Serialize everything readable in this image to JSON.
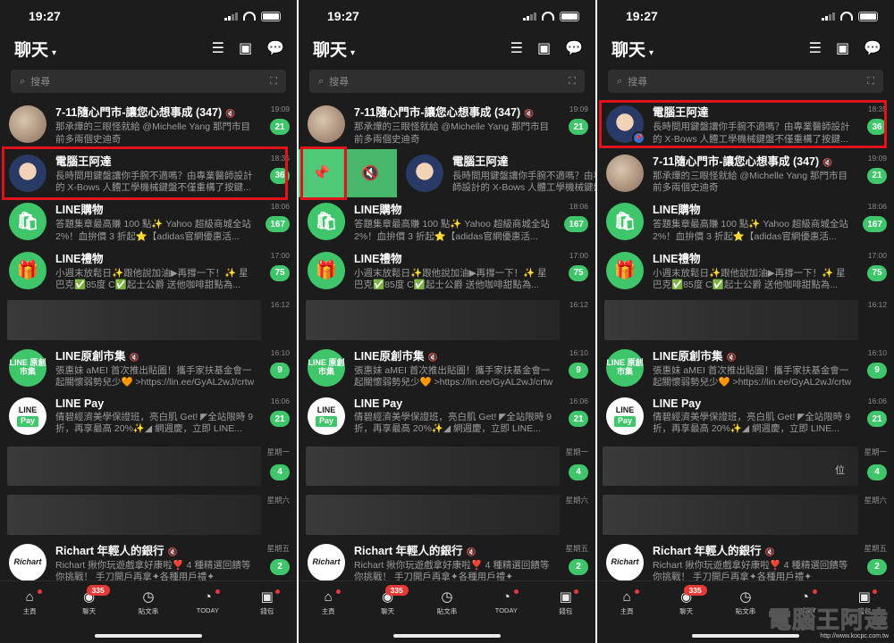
{
  "status": {
    "time": "19:27"
  },
  "header": {
    "title": "聊天",
    "caret": "▾"
  },
  "search": {
    "placeholder": "搜尋"
  },
  "chats": {
    "seven": {
      "name": "7-11隨心門市-讓您心想事成 (347)",
      "msg": "那承燁的三眼怪就給 @Michelle Yang 那門市目前多兩個史迪奇",
      "time": "19:09",
      "count": "21",
      "avatar_label": ""
    },
    "pc": {
      "name": "電腦王阿達",
      "msg": "長時間用鍵盤讓你手腕不適嗎？由專業醫師設計的 X-Bows 人體工學機械鍵盤不僅重構了按鍵...",
      "time": "18:35",
      "count": "36"
    },
    "shop": {
      "name": "LINE購物",
      "msg": "答題集章最高賺 100 點✨ Yahoo 超級商城全站2%！血拚價 3 折起⭐【adidas官網優惠活...",
      "time": "18:06",
      "count": "167"
    },
    "gift": {
      "name": "LINE禮物",
      "msg": "小週末放鬆日✨跟他說加油▶再撐一下！✨ 星巴克✅85度 C✅起士公爵 送他咖啡甜點為...",
      "time": "17:00",
      "count": "75"
    },
    "blur1": {
      "time": "16:12"
    },
    "creators": {
      "name": "LINE原創市集",
      "msg": "張惠妹 aMEI 首次推出貼圖！攜手家扶基金會一起關懷弱勢兒少🧡 >https://lin.ee/GyAL2wJ/crtw",
      "time": "16:10",
      "count": "9",
      "avatar_label": "LINE 原創市集"
    },
    "pay": {
      "name": "LINE Pay",
      "msg": "倩碧經濟美學保證班，亮白肌 Get! ◤全站限時 9 折，再享最高 20%✨◢ 網週慶，立即 LINE...",
      "time": "16:06",
      "count": "21",
      "avatar_line": "LINE",
      "avatar_pay": "Pay"
    },
    "blur2": {
      "time": "星期一",
      "count": "4"
    },
    "blur3": {
      "time": "星期六"
    },
    "richart": {
      "name": "Richart 年輕人的銀行",
      "msg": "Richart 揪你玩遊戲拿好康啦❣️ 4 種精選回饋等你挑戰！ 手刀開戶再拿✦各種用戶禮✦",
      "time": "星期五",
      "count": "2",
      "avatar_label": "Richart"
    }
  },
  "blur3_extra": "位",
  "tabs": [
    {
      "label": "主頁",
      "icon": "⌂"
    },
    {
      "label": "聊天",
      "icon": "◉",
      "badge": "335"
    },
    {
      "label": "貼文串",
      "icon": "◷"
    },
    {
      "label": "TODAY",
      "icon": "◔"
    },
    {
      "label": "錢包",
      "icon": "▣"
    }
  ],
  "watermark": {
    "title": "電腦王阿達",
    "url": "http://www.kocpc.com.tw"
  }
}
